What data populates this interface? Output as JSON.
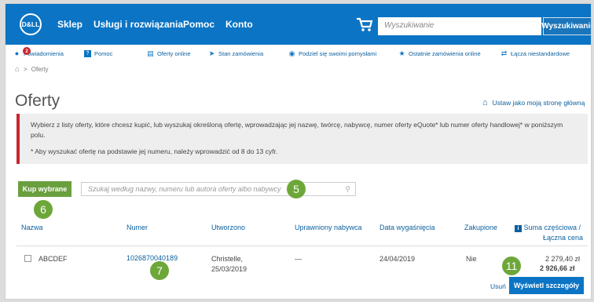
{
  "header": {
    "logo_text": "D&LL",
    "nav": [
      "Sklep",
      "Usługi i rozwiązania",
      "Pomoc",
      "Konto"
    ],
    "search_placeholder": "Wyszukiwanie",
    "search_button": "Wyszukiwanie"
  },
  "quick_links": [
    {
      "label": "Powiadomienia",
      "icon": "bell-icon",
      "badge": "2"
    },
    {
      "label": "Pomoc",
      "icon": "help-icon"
    },
    {
      "label": "Oferty online",
      "icon": "document-icon"
    },
    {
      "label": "Stan zamówienia",
      "icon": "shipping-icon"
    },
    {
      "label": "Podziel się swoimi pomysłami",
      "icon": "lightbulb-icon"
    },
    {
      "label": "Ostatnie zamówienia online",
      "icon": "star-icon"
    },
    {
      "label": "Łącza niestandardowe",
      "icon": "link-icon"
    }
  ],
  "breadcrumb": {
    "home_icon": "home-icon",
    "separator": ">",
    "current": "Oferty"
  },
  "page_title": "Oferty",
  "set_homepage": "Ustaw jako moją stronę główną",
  "info": {
    "line1": "Wybierz z listy oferty, które chcesz kupić, lub wyszukaj określoną ofertę, wprowadzając jej nazwę, twórcę, nabywcę, numer oferty eQuote* lub numer oferty handlowej* w poniższym polu.",
    "line2": "* Aby wyszukać ofertę na podstawie jej numeru, należy wprowadzić od 8 do 13 cyfr."
  },
  "buy_button": "Kup wybrane",
  "filter_placeholder": "Szukaj według nazwy, numeru lub autora oferty albo nabywcy",
  "callouts": {
    "c5": "5",
    "c6": "6",
    "c7": "7",
    "c11": "11"
  },
  "table": {
    "headers": {
      "name": "Nazwa",
      "number": "Numer",
      "created": "Utworzono",
      "buyer": "Uprawniony nabywca",
      "expiry": "Data wygaśnięcia",
      "purchased": "Zakupione",
      "total_line1": "Suma częściowa /",
      "total_line2": "Łączna cena",
      "info_icon": "info-icon"
    },
    "rows": [
      {
        "name": "ABCDEF",
        "number": "1026870040189",
        "created_by": "Christelle,",
        "created_date": "25/03/2019",
        "buyer": "—",
        "expiry": "24/04/2019",
        "purchased": "Nie",
        "subtotal": "2 279,40 zł",
        "total": "2 926,66 zł",
        "remove": "Usuń",
        "view": "Wyświetl szczegóły"
      }
    ]
  },
  "colors": {
    "brand_blue": "#0b74c4",
    "accent_green": "#6da739",
    "alert_red": "#c9252c"
  }
}
